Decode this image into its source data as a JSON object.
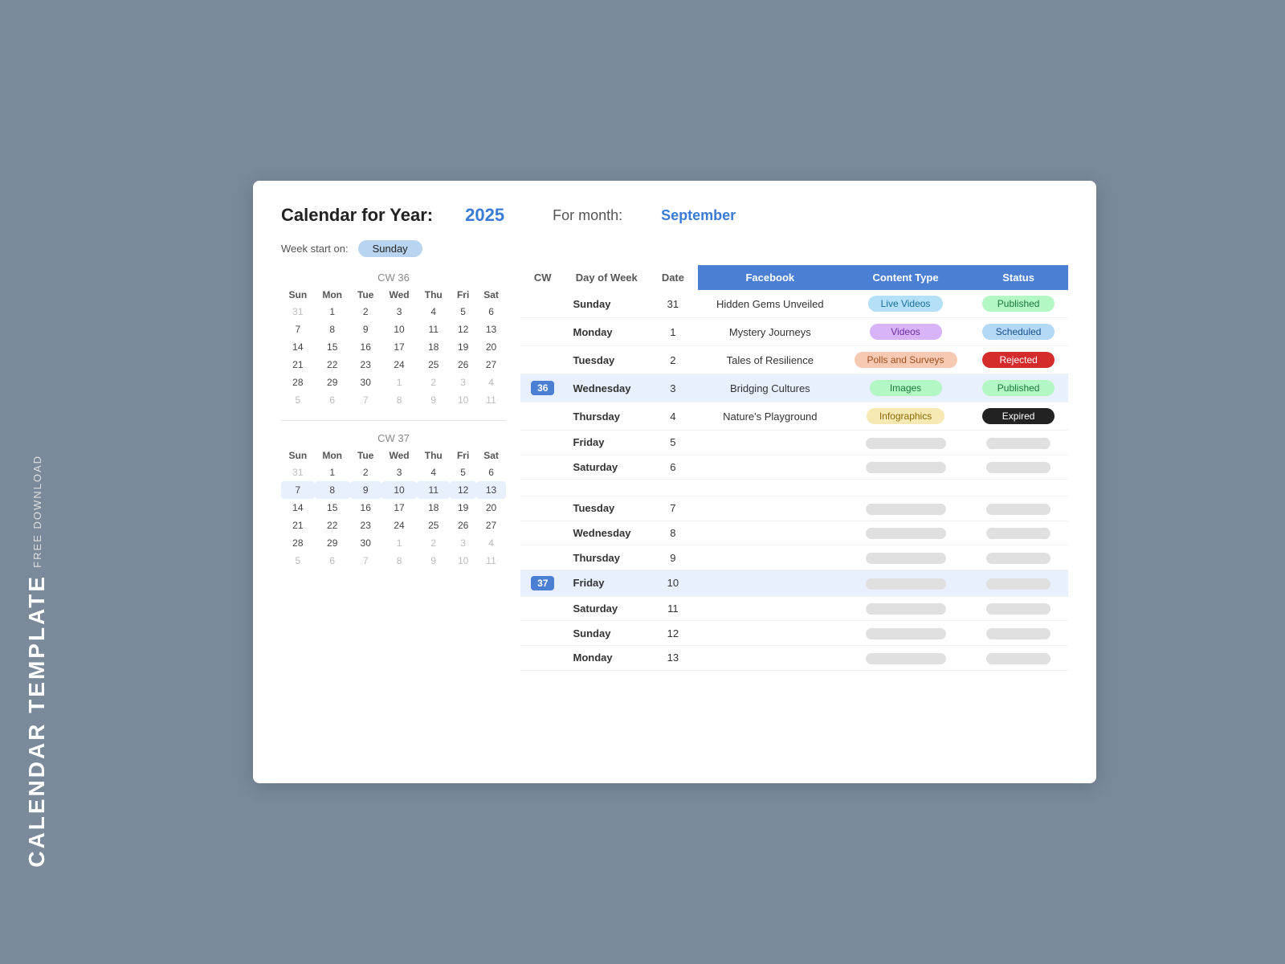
{
  "sidebar": {
    "free_download": "FREE DOWNLOAD",
    "calendar_template": "CALENDAR TEMPLATE"
  },
  "header": {
    "title": "Calendar for Year:",
    "year": "2025",
    "for_month": "For month:",
    "month": "September",
    "week_start_label": "Week start on:",
    "week_start_value": "Sunday"
  },
  "cw36": {
    "label": "CW 36",
    "days_header": [
      "Sun",
      "Mon",
      "Tue",
      "Wed",
      "Thu",
      "Fri",
      "Sat"
    ],
    "rows": [
      [
        "31",
        "1",
        "2",
        "3",
        "4",
        "5",
        "6"
      ],
      [
        "7",
        "8",
        "9",
        "10",
        "11",
        "12",
        "13"
      ],
      [
        "14",
        "15",
        "16",
        "17",
        "18",
        "19",
        "20"
      ],
      [
        "21",
        "22",
        "23",
        "24",
        "25",
        "26",
        "27"
      ],
      [
        "28",
        "29",
        "30",
        "1",
        "2",
        "3",
        "4"
      ],
      [
        "5",
        "6",
        "7",
        "8",
        "9",
        "10",
        "11"
      ]
    ]
  },
  "cw37": {
    "label": "CW 37",
    "days_header": [
      "Sun",
      "Mon",
      "Tue",
      "Wed",
      "Thu",
      "Fri",
      "Sat"
    ],
    "rows": [
      [
        "31",
        "1",
        "2",
        "3",
        "4",
        "5",
        "6"
      ],
      [
        "7",
        "8",
        "9",
        "10",
        "11",
        "12",
        "13"
      ],
      [
        "14",
        "15",
        "16",
        "17",
        "18",
        "19",
        "20"
      ],
      [
        "21",
        "22",
        "23",
        "24",
        "25",
        "26",
        "27"
      ],
      [
        "28",
        "29",
        "30",
        "1",
        "2",
        "3",
        "4"
      ],
      [
        "5",
        "6",
        "7",
        "8",
        "9",
        "10",
        "11"
      ]
    ]
  },
  "schedule": {
    "headers": {
      "cw": "CW",
      "day_of_week": "Day of Week",
      "date": "Date",
      "facebook": "Facebook",
      "content_type": "Content Type",
      "status": "Status"
    },
    "cw36_rows": [
      {
        "cw": "",
        "dow": "Sunday",
        "date": "31",
        "facebook": "Hidden Gems Unveiled",
        "content_type": "Live Videos",
        "content_type_class": "badge-live-videos",
        "status": "Published",
        "status_class": "badge-published-green"
      },
      {
        "cw": "",
        "dow": "Monday",
        "date": "1",
        "facebook": "Mystery Journeys",
        "content_type": "Videos",
        "content_type_class": "badge-videos",
        "status": "Scheduled",
        "status_class": "badge-scheduled-blue"
      },
      {
        "cw": "",
        "dow": "Tuesday",
        "date": "2",
        "facebook": "Tales of Resilience",
        "content_type": "Polls and Surveys",
        "content_type_class": "badge-polls",
        "status": "Rejected",
        "status_class": "badge-rejected-red"
      },
      {
        "cw": "36",
        "dow": "Wednesday",
        "date": "3",
        "facebook": "Bridging Cultures",
        "content_type": "Images",
        "content_type_class": "badge-images",
        "status": "Published",
        "status_class": "badge-published-green2"
      },
      {
        "cw": "",
        "dow": "Thursday",
        "date": "4",
        "facebook": "Nature's Playground",
        "content_type": "Infographics",
        "content_type_class": "badge-infographics",
        "status": "Expired",
        "status_class": "badge-expired-black"
      },
      {
        "cw": "",
        "dow": "Friday",
        "date": "5",
        "facebook": "",
        "content_type": "",
        "content_type_class": "",
        "status": "",
        "status_class": ""
      },
      {
        "cw": "",
        "dow": "Saturday",
        "date": "6",
        "facebook": "",
        "content_type": "",
        "content_type_class": "",
        "status": "",
        "status_class": ""
      }
    ],
    "cw37_rows": [
      {
        "cw": "",
        "dow": "Tuesday",
        "date": "7",
        "facebook": "",
        "content_type": "",
        "content_type_class": "",
        "status": "",
        "status_class": ""
      },
      {
        "cw": "",
        "dow": "Wednesday",
        "date": "8",
        "facebook": "",
        "content_type": "",
        "content_type_class": "",
        "status": "",
        "status_class": ""
      },
      {
        "cw": "",
        "dow": "Thursday",
        "date": "9",
        "facebook": "",
        "content_type": "",
        "content_type_class": "",
        "status": "",
        "status_class": ""
      },
      {
        "cw": "37",
        "dow": "Friday",
        "date": "10",
        "facebook": "",
        "content_type": "",
        "content_type_class": "",
        "status": "",
        "status_class": ""
      },
      {
        "cw": "",
        "dow": "Saturday",
        "date": "11",
        "facebook": "",
        "content_type": "",
        "content_type_class": "",
        "status": "",
        "status_class": ""
      },
      {
        "cw": "",
        "dow": "Sunday",
        "date": "12",
        "facebook": "",
        "content_type": "",
        "content_type_class": "",
        "status": "",
        "status_class": ""
      },
      {
        "cw": "",
        "dow": "Monday",
        "date": "13",
        "facebook": "",
        "content_type": "",
        "content_type_class": "",
        "status": "",
        "status_class": ""
      }
    ]
  }
}
